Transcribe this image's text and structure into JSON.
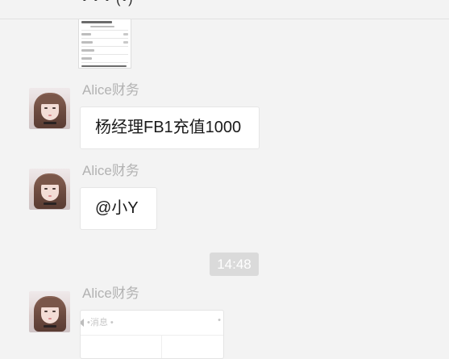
{
  "header": {
    "title_partial": "• • • (•)"
  },
  "messages": [
    {
      "sender": "Alice财务",
      "text": "杨经理FB1充值1000"
    },
    {
      "sender": "Alice财务",
      "text": "@小Y"
    },
    {
      "sender": "Alice财务",
      "card_label": "•消息  •",
      "card_label_right": "•"
    }
  ],
  "timestamp": "14:48",
  "colors": {
    "background": "#f3f3f3",
    "bubble": "#ffffff",
    "sender_text": "#b2b2b2",
    "time_badge": "#dadada"
  }
}
